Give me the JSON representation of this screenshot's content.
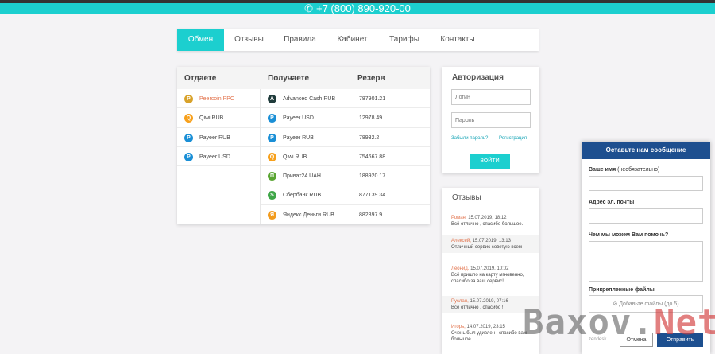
{
  "topbar": {
    "phone": "+7 (800) 890-920-00"
  },
  "nav": {
    "tabs": [
      {
        "label": "Обмен",
        "active": true
      },
      {
        "label": "Отзывы",
        "active": false
      },
      {
        "label": "Правила",
        "active": false
      },
      {
        "label": "Кабинет",
        "active": false
      },
      {
        "label": "Тарифы",
        "active": false
      },
      {
        "label": "Контакты",
        "active": false
      }
    ]
  },
  "exchange": {
    "col_give": "Отдаете",
    "col_get": "Получаете",
    "col_reserve": "Резерв",
    "give": [
      {
        "name": "Peercoin PPC",
        "icon": "peercoin-icon",
        "color": "#d8a22a",
        "glyph": "P",
        "highlight": true
      },
      {
        "name": "Qiwi RUB",
        "icon": "qiwi-icon",
        "color": "#f7a01b",
        "glyph": "Q",
        "highlight": false
      },
      {
        "name": "Payeer RUB",
        "icon": "payeer-icon",
        "color": "#1a8fd6",
        "glyph": "P",
        "highlight": false
      },
      {
        "name": "Payeer USD",
        "icon": "payeer-icon",
        "color": "#1a8fd6",
        "glyph": "P",
        "highlight": false
      }
    ],
    "get": [
      {
        "name": "Advanced Cash RUB",
        "reserve": "787901.21",
        "icon": "advcash-icon",
        "color": "#1f3b3b",
        "glyph": "A"
      },
      {
        "name": "Payeer USD",
        "reserve": "12978.49",
        "icon": "payeer-icon",
        "color": "#1a8fd6",
        "glyph": "P"
      },
      {
        "name": "Payeer RUB",
        "reserve": "78932.2",
        "icon": "payeer-icon",
        "color": "#1a8fd6",
        "glyph": "P"
      },
      {
        "name": "Qiwi RUB",
        "reserve": "754667.88",
        "icon": "qiwi-icon",
        "color": "#f7a01b",
        "glyph": "Q"
      },
      {
        "name": "Приват24 UAH",
        "reserve": "188920.17",
        "icon": "privat24-icon",
        "color": "#5aa532",
        "glyph": "П"
      },
      {
        "name": "Сбербанк RUB",
        "reserve": "877139.34",
        "icon": "sberbank-icon",
        "color": "#3ea647",
        "glyph": "S"
      },
      {
        "name": "Яндекс.Деньги RUB",
        "reserve": "882897.9",
        "icon": "yandex-money-icon",
        "color": "#f29b1d",
        "glyph": "Я"
      }
    ]
  },
  "auth": {
    "title": "Авторизация",
    "login_placeholder": "Логин",
    "password_placeholder": "Пароль",
    "forgot": "Забыли пароль?",
    "register": "Регистрация",
    "submit": "ВОЙТИ"
  },
  "reviews": {
    "title": "Отзывы",
    "items": [
      {
        "name": "Роман,",
        "date": "15.07.2019, 18:12",
        "text": "Всё отлично , спасибо большое."
      },
      {
        "name": "Алексей,",
        "date": "15.07.2019, 13:13",
        "text": "Отличный сервис советую всем !"
      },
      {
        "name": "Леонид,",
        "date": "15.07.2019, 10:02",
        "text": "Всё пришло на карту мгновенно, спасибо за ваш сервис!"
      },
      {
        "name": "Руслан,",
        "date": "15.07.2019, 07:16",
        "text": "Всё отлично , спасибо !"
      },
      {
        "name": "Игорь,",
        "date": "14.07.2019, 23:15",
        "text": "Очень был удивлен , спасибо вам большое."
      }
    ]
  },
  "chat": {
    "title": "Оставьте нам сообщение",
    "minimize": "–",
    "name_label": "Ваше имя",
    "name_hint": "(необязательно)",
    "email_label": "Адрес эл. почты",
    "help_label": "Чем мы можем Вам помочь?",
    "attach_label": "Прикрепленные файлы",
    "attach_button": "Добавьте файлы (до 5)",
    "brand": "zendesk",
    "cancel": "Отмена",
    "send": "Отправить"
  },
  "watermark": {
    "part1": "Baxov.",
    "part2": "Net"
  }
}
